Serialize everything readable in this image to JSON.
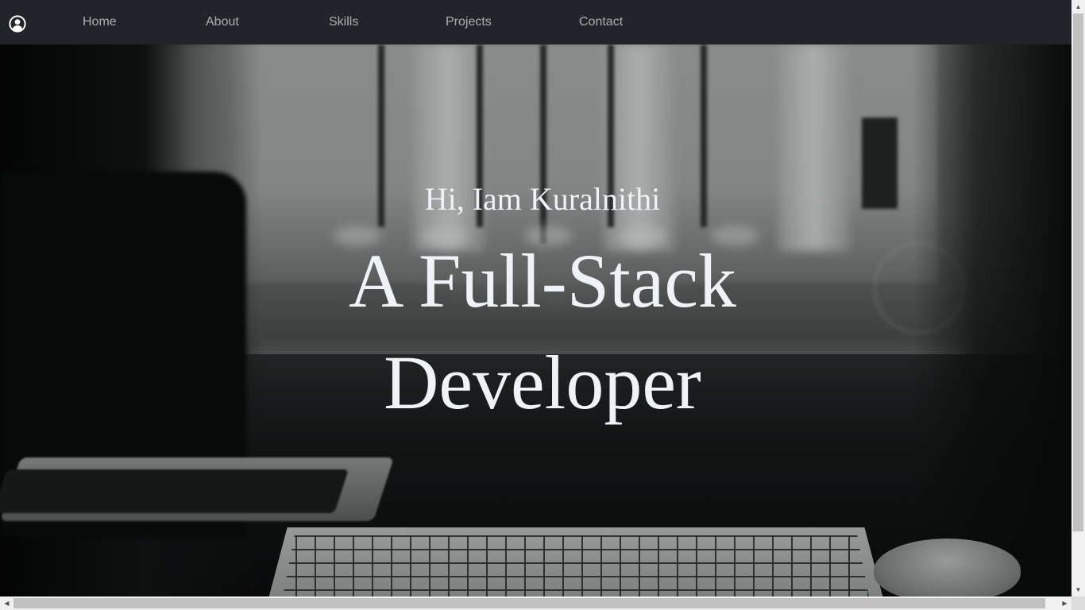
{
  "navbar": {
    "brand_icon": "user-circle-icon",
    "items": [
      {
        "label": "Home"
      },
      {
        "label": "About"
      },
      {
        "label": "Skills"
      },
      {
        "label": "Projects"
      },
      {
        "label": "Contact"
      }
    ]
  },
  "hero": {
    "greeting": "Hi, Iam Kuralnithi",
    "headline_line1": "A Full-Stack",
    "headline_line2": "Developer"
  },
  "colors": {
    "navbar_bg": "#212529",
    "nav_text": "#9a9c9e",
    "hero_text": "#eef3f8"
  }
}
